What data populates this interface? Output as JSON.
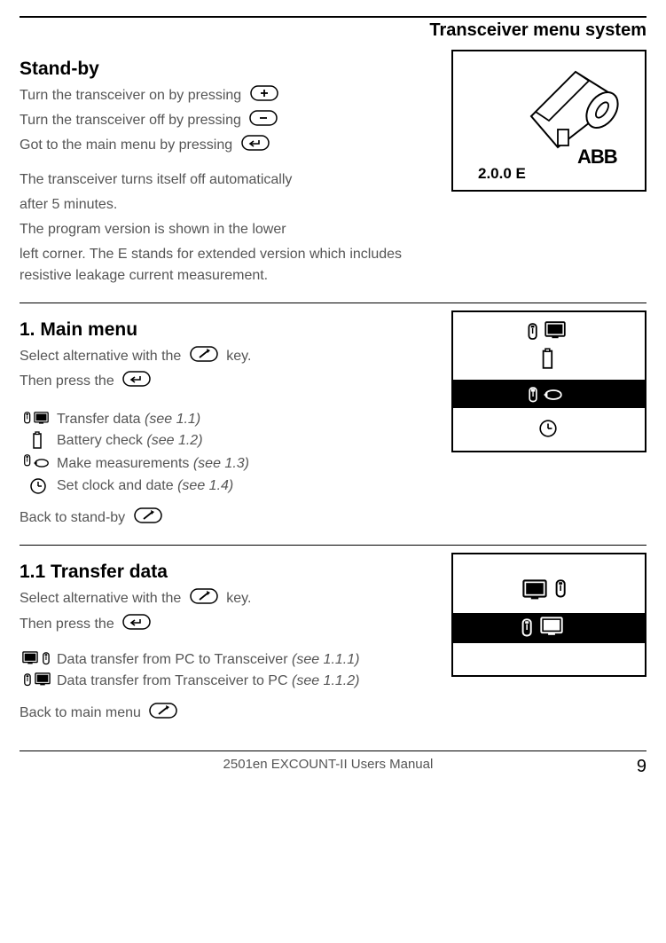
{
  "header": {
    "title": "Transceiver menu system"
  },
  "standby": {
    "heading": "Stand-by",
    "line_on": "Turn the transceiver on by pressing",
    "line_off": "Turn the transceiver off by pressing",
    "line_menu": "Got to the main menu by pressing",
    "auto_off_1": "The transceiver turns itself off automatically",
    "auto_off_2": "after 5 minutes.",
    "version_1": "The program version is shown in the lower",
    "version_2": "left corner. The E stands for extended version which includes resistive leakage current measurement.",
    "fig_version": "2.0.0 E",
    "fig_brand": "ABB"
  },
  "mainmenu": {
    "heading": "1. Main menu",
    "select_pre": "Select alternative with the",
    "select_post": "key.",
    "then_press": "Then press the",
    "item1": "Transfer data",
    "item1_ref": "(see 1.1)",
    "item2": "Battery check",
    "item2_ref": "(see 1.2)",
    "item3": "Make measurements",
    "item3_ref": "(see 1.3)",
    "item4": "Set clock and date",
    "item4_ref": "(see 1.4)",
    "back": "Back to stand-by"
  },
  "transfer": {
    "heading": "1.1 Transfer data",
    "select_pre": "Select alternative with the",
    "select_post": "key.",
    "then_press": "Then press the",
    "item1": "Data transfer from PC to Transceiver",
    "item1_ref": "(see 1.1.1)",
    "item2": "Data transfer from Transceiver to PC",
    "item2_ref": "(see 1.1.2)",
    "back": "Back to main menu"
  },
  "footer": {
    "doc": "2501en EXCOUNT-II Users Manual",
    "page": "9"
  }
}
